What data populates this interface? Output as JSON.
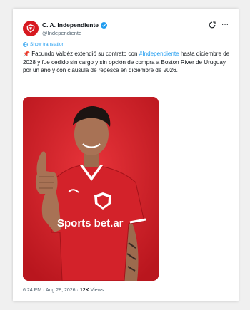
{
  "account": {
    "display_name": "C. A. Independiente",
    "handle": "@Independiente",
    "avatar_color": "#d71920",
    "verified_icon": "verified-badge-icon"
  },
  "actions": {
    "grok_icon": "grok-icon",
    "more_label": "···"
  },
  "translation": {
    "label": "Show translation",
    "icon": "globe-icon"
  },
  "tweet": {
    "pin_emoji": "📌",
    "text_before": " Facundo Valdéz extendió su contrato con ",
    "hashtag": "#Independiente",
    "text_after": " hasta diciembre de 2028 y fue cedido sin cargo y sin opción de compra a Boston River de Uruguay, por un año y con cláusula de repesca en diciembre de 2026."
  },
  "media": {
    "sponsor": "Sports bet.ar",
    "brand_color": "#d3222a"
  },
  "meta": {
    "time": "6:24 PM",
    "separator": " · ",
    "date": "Aug 28, 2026",
    "views_count": "12K",
    "views_label": " Views"
  },
  "colors": {
    "link": "#1d9bf0",
    "secondary_text": "#536471",
    "primary_text": "#0f1419"
  }
}
